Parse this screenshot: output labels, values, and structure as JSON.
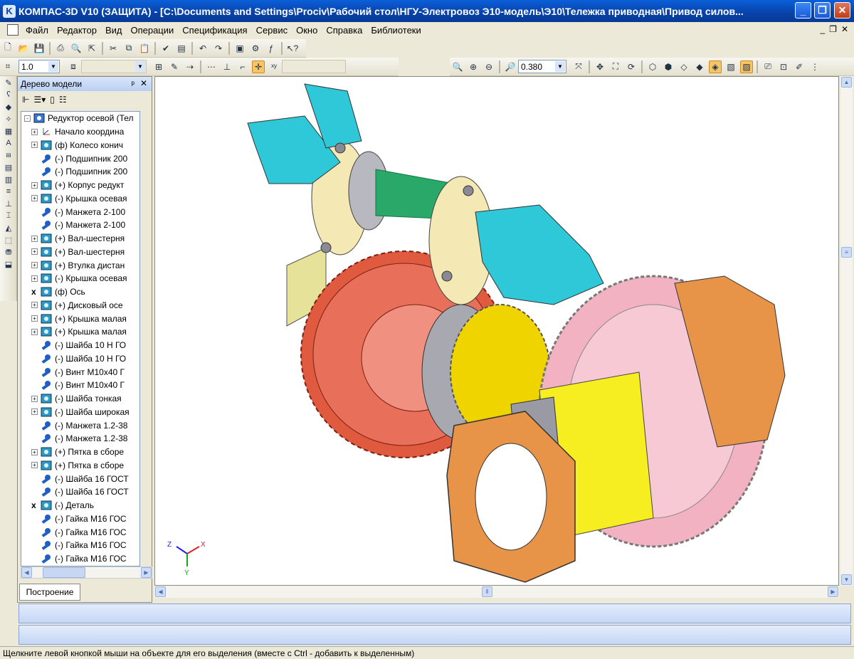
{
  "window": {
    "title": "КОМПАС-3D V10 (ЗАЩИТА) - [C:\\Documents and Settings\\Prociv\\Рабочий стол\\НГУ-Электровоз Э10-модель\\Э10\\Тележка приводная\\Привод силов...",
    "min_label": "_",
    "max_label": "❐",
    "close_label": "✕"
  },
  "menu": {
    "items": [
      "Файл",
      "Редактор",
      "Вид",
      "Операции",
      "Спецификация",
      "Сервис",
      "Окно",
      "Справка",
      "Библиотеки"
    ],
    "mdi": [
      "_",
      "❐",
      "✕"
    ]
  },
  "toolbar": {
    "step_value": "1.0",
    "zoom_value": "0.380"
  },
  "tree_panel": {
    "title": "Дерево модели",
    "pin": "ᵖ",
    "close": "✕",
    "tab_label": "Построение",
    "items": [
      {
        "text": "Редуктор осевой (Тел",
        "expander": "-",
        "icon": "assembly-icon"
      },
      {
        "text": "Начало координа",
        "expander": "+",
        "icon": "origin-icon"
      },
      {
        "text": "(ф) Колесо конич",
        "expander": "+",
        "icon": "part-icon"
      },
      {
        "text": "(-) Подшипник 200",
        "expander": "",
        "icon": "component-icon"
      },
      {
        "text": "(-) Подшипник 200",
        "expander": "",
        "icon": "component-icon"
      },
      {
        "text": "(+) Корпус редукт",
        "expander": "+",
        "icon": "part-icon"
      },
      {
        "text": "(-) Крышка осевая",
        "expander": "+",
        "icon": "part-icon"
      },
      {
        "text": "(-) Манжета 2-100",
        "expander": "",
        "icon": "component-icon"
      },
      {
        "text": "(-) Манжета 2-100",
        "expander": "",
        "icon": "component-icon"
      },
      {
        "text": "(+) Вал-шестерня",
        "expander": "+",
        "icon": "part-icon"
      },
      {
        "text": "(+) Вал-шестерня",
        "expander": "+",
        "icon": "part-icon"
      },
      {
        "text": "(+) Втулка дистан",
        "expander": "+",
        "icon": "part-icon"
      },
      {
        "text": "(-) Крышка осевая",
        "expander": "+",
        "icon": "part-icon"
      },
      {
        "text": "(ф) Ось",
        "expander": "x",
        "icon": "part-icon"
      },
      {
        "text": "(+) Дисковый осе",
        "expander": "+",
        "icon": "part-icon"
      },
      {
        "text": "(+) Крышка малая",
        "expander": "+",
        "icon": "part-icon"
      },
      {
        "text": "(+) Крышка малая",
        "expander": "+",
        "icon": "part-icon"
      },
      {
        "text": "(-) Шайба 10 Н ГО",
        "expander": "",
        "icon": "component-icon"
      },
      {
        "text": "(-) Шайба 10 Н ГО",
        "expander": "",
        "icon": "component-icon"
      },
      {
        "text": "(-) Винт M10x40 Г",
        "expander": "",
        "icon": "component-icon"
      },
      {
        "text": "(-) Винт M10x40 Г",
        "expander": "",
        "icon": "component-icon"
      },
      {
        "text": "(-) Шайба тонкая",
        "expander": "+",
        "icon": "part-icon"
      },
      {
        "text": "(-) Шайба широкая",
        "expander": "+",
        "icon": "part-icon"
      },
      {
        "text": "(-) Манжета 1.2-38",
        "expander": "",
        "icon": "component-icon"
      },
      {
        "text": "(-) Манжета 1.2-38",
        "expander": "",
        "icon": "component-icon"
      },
      {
        "text": "(+) Пятка в сборе",
        "expander": "+",
        "icon": "part-icon"
      },
      {
        "text": "(+) Пятка в сборе",
        "expander": "+",
        "icon": "part-icon"
      },
      {
        "text": "(-) Шайба 16 ГОСТ",
        "expander": "",
        "icon": "component-icon"
      },
      {
        "text": "(-) Шайба 16 ГОСТ",
        "expander": "",
        "icon": "component-icon"
      },
      {
        "text": "(-) Деталь",
        "expander": "x",
        "icon": "part-icon"
      },
      {
        "text": "(-) Гайка M16 ГОС",
        "expander": "",
        "icon": "component-icon"
      },
      {
        "text": "(-) Гайка M16 ГОС",
        "expander": "",
        "icon": "component-icon"
      },
      {
        "text": "(-) Гайка M16 ГОС",
        "expander": "",
        "icon": "component-icon"
      },
      {
        "text": "(-) Гайка M16 ГОС",
        "expander": "",
        "icon": "component-icon"
      }
    ]
  },
  "axes": {
    "x": "X",
    "y": "Y",
    "z": "Z"
  },
  "status": {
    "text": "Щелкните левой кнопкой мыши на объекте для его выделения (вместе с Ctrl - добавить к выделенным)"
  },
  "colors": {
    "cyan_part": "#2ec8d8",
    "gear_red": "#e05a40",
    "gear_pink": "#f2b2c2",
    "bevel_yellow": "#f0d400",
    "nut_orange": "#e89448",
    "shaft_green": "#2aa86a"
  }
}
